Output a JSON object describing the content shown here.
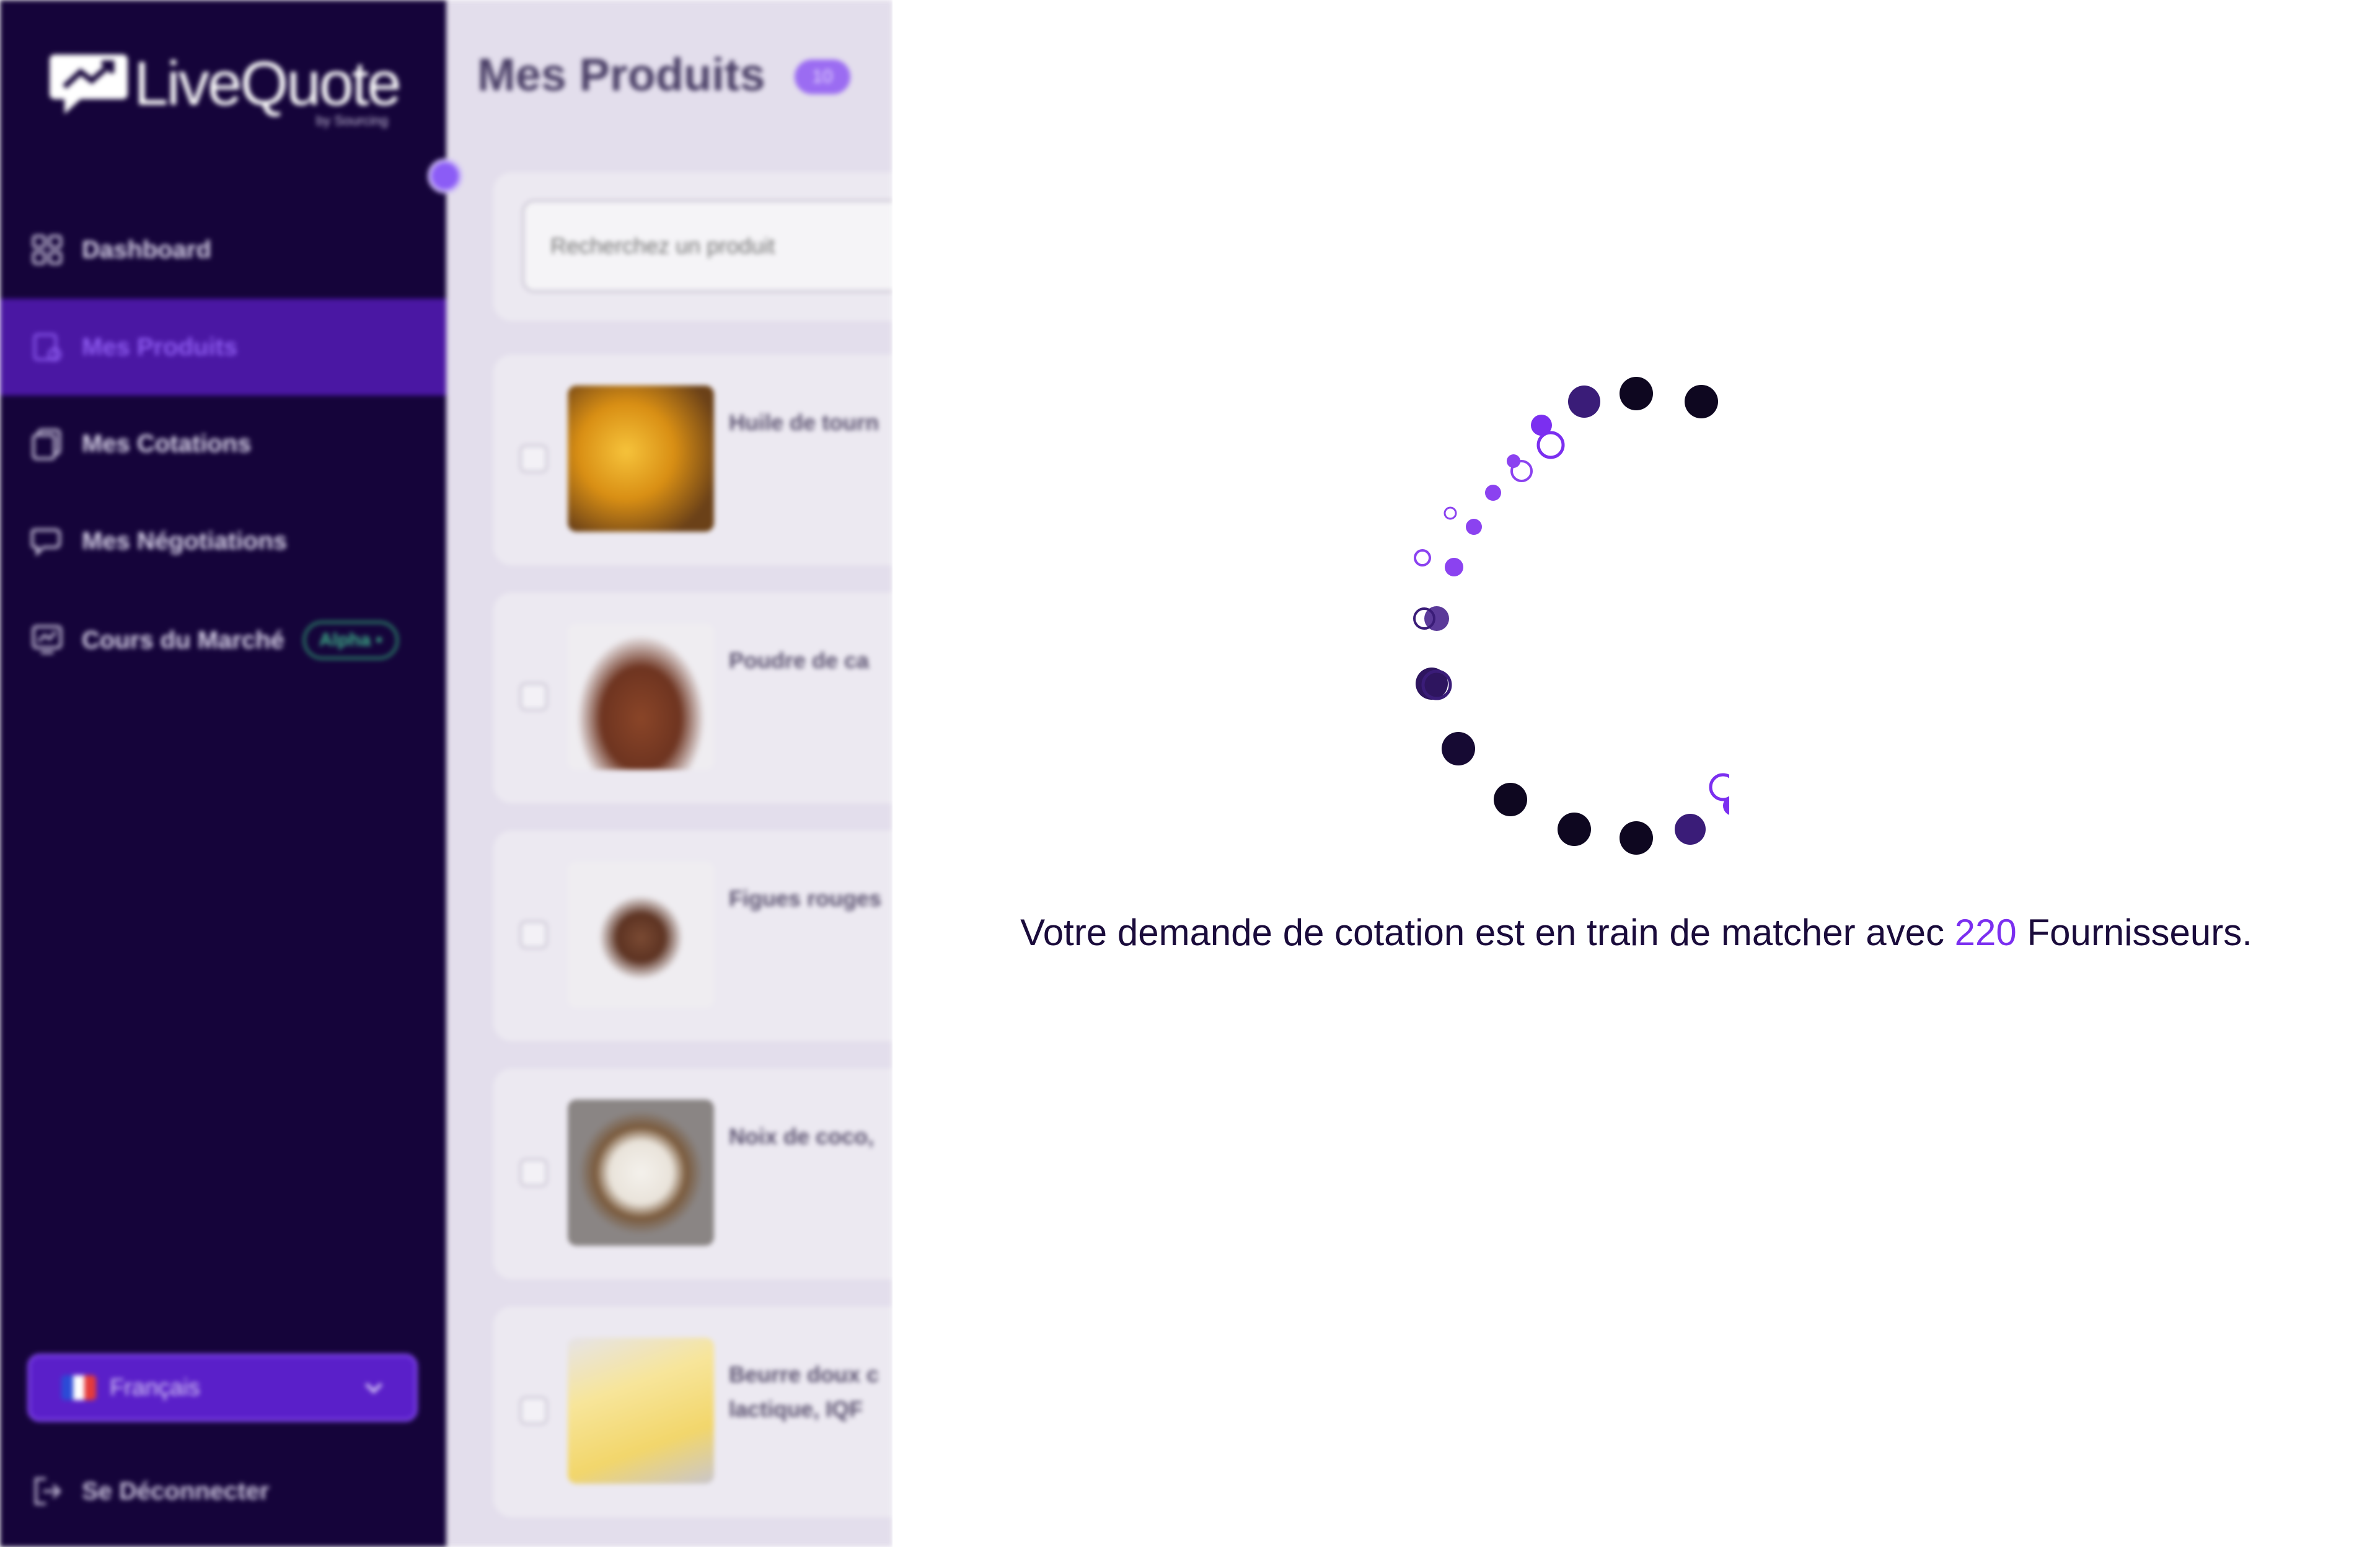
{
  "app": {
    "logo_text": "LiveQuote",
    "logo_sub": "by Sourcing"
  },
  "sidebar": {
    "items": [
      {
        "label": "Dashboard",
        "icon": "grid-icon",
        "active": false
      },
      {
        "label": "Mes Produits",
        "icon": "box-icon",
        "active": true
      },
      {
        "label": "Mes Cotations",
        "icon": "stack-icon",
        "active": false
      },
      {
        "label": "Mes Négotiations",
        "icon": "chat-icon",
        "active": false
      },
      {
        "label": "Cours du Marché",
        "icon": "chart-icon",
        "active": false,
        "badge": "Alpha •"
      }
    ],
    "language": "Français",
    "logout": "Se Déconnecter"
  },
  "main": {
    "title": "Mes Produits",
    "count": "10",
    "search_placeholder": "Recherchez un produit",
    "products": [
      {
        "name": "Huile de tourn"
      },
      {
        "name": "Poudre de ca"
      },
      {
        "name": "Figues rouges"
      },
      {
        "name": "Noix de coco,"
      },
      {
        "name": "Beurre doux c lactique, IQF"
      }
    ]
  },
  "overlay": {
    "message_before": "Votre demande de cotation est en train de matcher avec",
    "supplier_count": "220",
    "message_after": "Fournisseurs."
  },
  "colors": {
    "sidebar_bg": "#15043a",
    "accent_purple": "#7b2ff0",
    "dot_dark": "#0e0720"
  }
}
